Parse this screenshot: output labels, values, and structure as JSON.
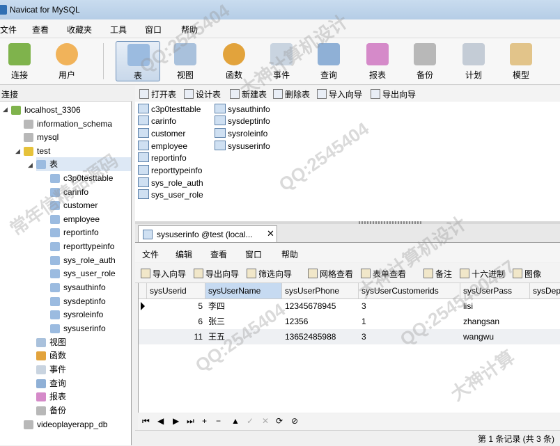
{
  "window": {
    "title": "Navicat for MySQL"
  },
  "menu": [
    "文件",
    "查看",
    "收藏夹",
    "工具",
    "窗口",
    "帮助"
  ],
  "toolbar": [
    {
      "label": "连接",
      "icon": "connection-icon"
    },
    {
      "label": "用户",
      "icon": "user-icon"
    },
    {
      "label": "表",
      "icon": "table-icon"
    },
    {
      "label": "视图",
      "icon": "view-icon"
    },
    {
      "label": "函数",
      "icon": "function-icon"
    },
    {
      "label": "事件",
      "icon": "event-icon"
    },
    {
      "label": "查询",
      "icon": "query-icon"
    },
    {
      "label": "报表",
      "icon": "report-icon"
    },
    {
      "label": "备份",
      "icon": "backup-icon"
    },
    {
      "label": "计划",
      "icon": "schedule-icon"
    },
    {
      "label": "模型",
      "icon": "model-icon"
    }
  ],
  "connection_header": "连接",
  "tree": {
    "connection": "localhost_3306",
    "databases": [
      "information_schema",
      "mysql",
      "test"
    ],
    "tables_node": "表",
    "tables": [
      "c3p0testtable",
      "carinfo",
      "customer",
      "employee",
      "reportinfo",
      "reporttypeinfo",
      "sys_role_auth",
      "sys_user_role",
      "sysauthinfo",
      "sysdeptinfo",
      "sysroleinfo",
      "sysuserinfo"
    ],
    "other_nodes": [
      "视图",
      "函数",
      "事件",
      "查询",
      "报表",
      "备份"
    ],
    "other_db": "videoplayerapp_db"
  },
  "object_toolbar": [
    "打开表",
    "设计表",
    "新建表",
    "删除表",
    "导入向导",
    "导出向导"
  ],
  "object_list": [
    "c3p0testtable",
    "carinfo",
    "customer",
    "employee",
    "reportinfo",
    "reporttypeinfo",
    "sys_role_auth",
    "sys_user_role",
    "sysauthinfo",
    "sysdeptinfo",
    "sysroleinfo",
    "sysuserinfo"
  ],
  "tab": {
    "label": "sysuserinfo @test (local...",
    "close": "✕"
  },
  "sub_menu": [
    "文件",
    "编辑",
    "查看",
    "窗口",
    "帮助"
  ],
  "sub_toolbar": [
    "导入向导",
    "导出向导",
    "筛选向导",
    "网格查看",
    "表单查看",
    "备注",
    "十六进制",
    "图像"
  ],
  "grid": {
    "columns": [
      "sysUserid",
      "sysUserName",
      "sysUserPhone",
      "sysUserCustomerids",
      "sysUserPass",
      "sysDep"
    ],
    "rows": [
      [
        "5",
        "李四",
        "12345678945",
        "3",
        "lisi"
      ],
      [
        "6",
        "张三",
        "12356",
        "1",
        "zhangsan"
      ],
      [
        "11",
        "王五",
        "13652485988",
        "3",
        "wangwu"
      ]
    ]
  },
  "nav_buttons": [
    "⏮",
    "◀",
    "▶",
    "⏭",
    "+",
    "−",
    "▲",
    "✓",
    "✕",
    "⟳",
    "⊘"
  ],
  "status": "第 1 条记录 (共 3 条)",
  "watermarks": [
    "QQ:2545404",
    "大神计算机设计",
    "QQ:2545404",
    "常年信精品源码",
    "大神计算机设计",
    "QQ:2545404",
    "QQ:2545400457",
    "大神计算"
  ]
}
